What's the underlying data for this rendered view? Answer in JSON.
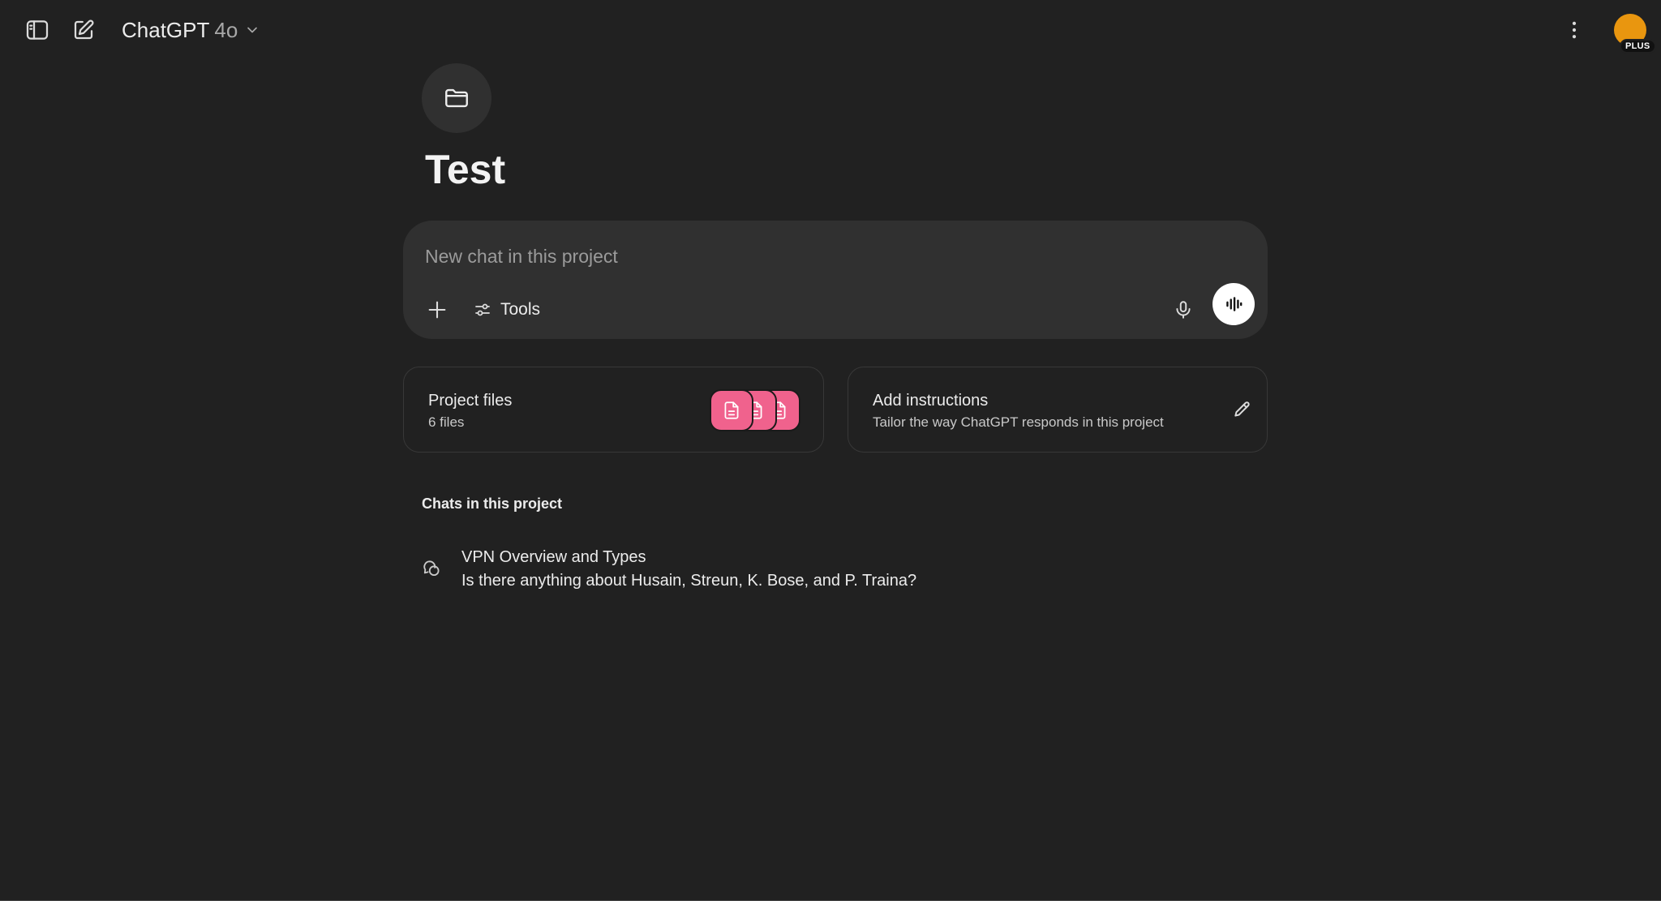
{
  "header": {
    "model_name": "ChatGPT",
    "model_version": "4o",
    "plan_badge": "PLUS"
  },
  "project": {
    "title": "Test"
  },
  "composer": {
    "placeholder": "New chat in this project",
    "tools_label": "Tools"
  },
  "cards": {
    "files": {
      "title": "Project files",
      "subtitle": "6 files"
    },
    "instructions": {
      "title": "Add instructions",
      "subtitle": "Tailor the way ChatGPT responds in this project"
    }
  },
  "chats": {
    "section_label": "Chats in this project",
    "items": [
      {
        "title": "VPN Overview and Types",
        "preview": "Is there anything about Husain, Streun, K. Bose, and P. Traina?"
      }
    ]
  },
  "icons": {
    "sidebar_toggle": "sidebar-toggle-icon",
    "new_chat": "compose-icon",
    "model_dropdown": "chevron-down-icon",
    "more": "more-vertical-icon",
    "folder": "folder-icon",
    "add": "plus-icon",
    "tools": "sliders-icon",
    "mic": "mic-icon",
    "voice": "waveform-icon",
    "file": "document-icon",
    "edit": "pencil-icon",
    "chat": "chat-bubbles-icon"
  },
  "colors": {
    "background": "#212121",
    "surface": "#303030",
    "avatar": "#e9960f",
    "file_tile": "#f0628d"
  }
}
